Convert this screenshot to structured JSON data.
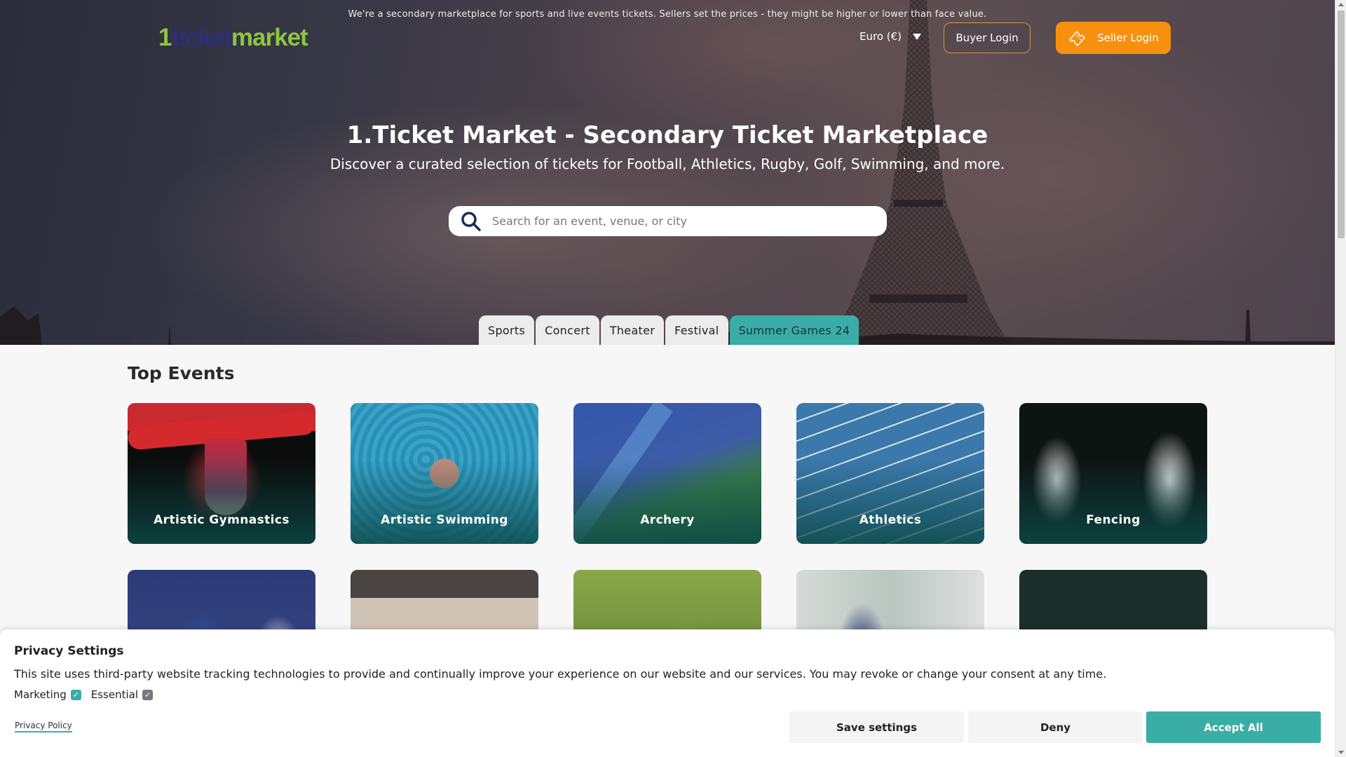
{
  "header": {
    "notice": "We're a secondary marketplace for sports and live events tickets. Sellers set the prices - they might be higher or lower than face value.",
    "logo": {
      "part1": "1",
      "part2": "ticket",
      "part3": "market"
    },
    "currency": "Euro (€)",
    "buyer_login": "Buyer Login",
    "seller_login": "Seller Login"
  },
  "hero": {
    "title": "1.Ticket Market - Secondary Ticket Marketplace",
    "subtitle": "Discover a curated selection of tickets for Football, Athletics, Rugby, Golf, Swimming, and more.",
    "search_placeholder": "Search for an event, venue, or city",
    "search_value": ""
  },
  "tabs": [
    {
      "label": "Sports",
      "active": false
    },
    {
      "label": "Concert",
      "active": false
    },
    {
      "label": "Theater",
      "active": false
    },
    {
      "label": "Festival",
      "active": false
    },
    {
      "label": "Summer Games 24",
      "active": true
    }
  ],
  "top_events": {
    "title": "Top Events",
    "cards": [
      {
        "label": "Artistic Gymnastics"
      },
      {
        "label": "Artistic Swimming"
      },
      {
        "label": "Archery"
      },
      {
        "label": "Athletics"
      },
      {
        "label": "Fencing"
      },
      {
        "label": ""
      },
      {
        "label": ""
      },
      {
        "label": ""
      },
      {
        "label": ""
      },
      {
        "label": ""
      }
    ]
  },
  "privacy": {
    "title": "Privacy Settings",
    "description": "This site uses third-party website tracking technologies to provide and continually improve your experience on our website and our services. You may revoke or change your consent at any time.",
    "marketing_label": "Marketing",
    "marketing_checked": true,
    "essential_label": "Essential",
    "essential_checked": true,
    "policy_link": "Privacy Policy",
    "save_label": "Save settings",
    "deny_label": "Deny",
    "accept_label": "Accept All"
  },
  "colors": {
    "accent_teal": "#3aada6",
    "seller_orange": "#f7900f",
    "logo_green": "#8cc63f",
    "logo_navy": "#2b2f7a"
  }
}
